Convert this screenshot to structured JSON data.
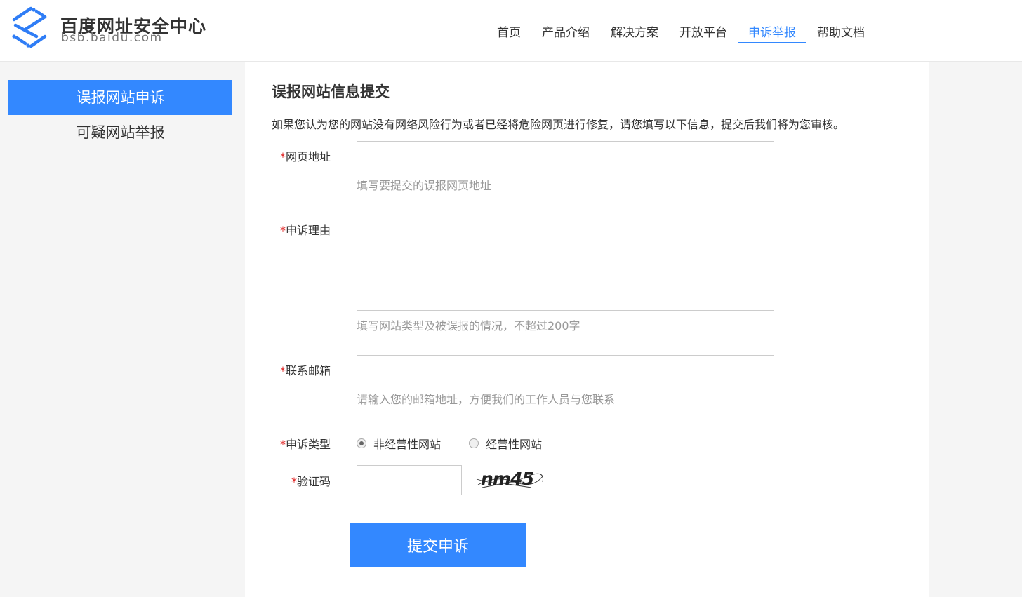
{
  "header": {
    "logo_title": "百度网址安全中心",
    "logo_sub": "bsb.baidu.com",
    "nav": [
      {
        "label": "首页"
      },
      {
        "label": "产品介绍"
      },
      {
        "label": "解决方案"
      },
      {
        "label": "开放平台"
      },
      {
        "label": "申诉举报",
        "active": true
      },
      {
        "label": "帮助文档"
      }
    ]
  },
  "sidebar": {
    "items": [
      {
        "label": "误报网站申诉",
        "active": true
      },
      {
        "label": "可疑网站举报"
      }
    ]
  },
  "form": {
    "title": "误报网站信息提交",
    "description": "如果您认为您的网站没有网络风险行为或者已经将危险网页进行修复，请您填写以下信息，提交后我们将为您审核。",
    "required_mark": "*",
    "url": {
      "label": "网页地址",
      "value": "",
      "hint": "填写要提交的误报网页地址"
    },
    "reason": {
      "label": "申诉理由",
      "value": "",
      "hint": "填写网站类型及被误报的情况，不超过200字"
    },
    "email": {
      "label": "联系邮箱",
      "value": "",
      "hint": "请输入您的邮箱地址，方便我们的工作人员与您联系"
    },
    "type": {
      "label": "申诉类型",
      "options": [
        {
          "label": "非经营性网站",
          "checked": true
        },
        {
          "label": "经营性网站",
          "checked": false
        }
      ]
    },
    "captcha": {
      "label": "验证码",
      "value": "",
      "image_text": "nm45"
    },
    "submit_label": "提交申诉"
  },
  "colors": {
    "accent": "#3388ff",
    "required": "#e02020",
    "hint": "#999999"
  }
}
